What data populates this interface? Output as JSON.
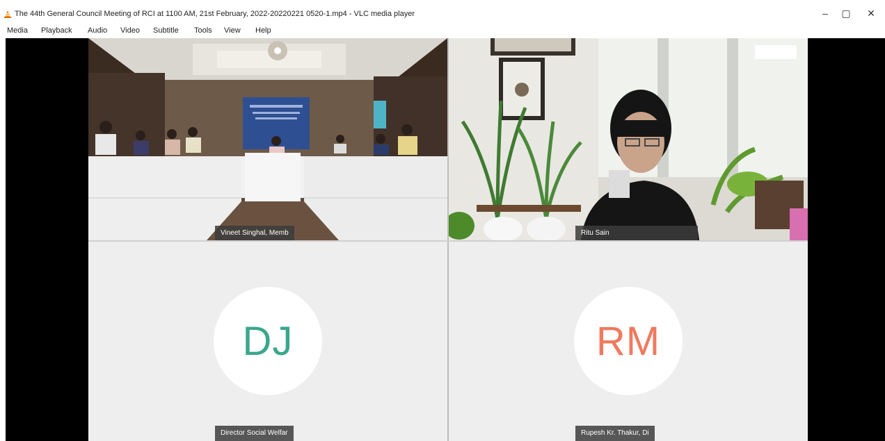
{
  "window": {
    "title": "The 44th General Council Meeting of RCI  at 1100 AM, 21st February, 2022-20220221 0520-1.mp4 - VLC media player",
    "minimize_glyph": "–",
    "maximize_glyph": "▢",
    "close_glyph": "✕",
    "app_icon": "vlc-cone-icon",
    "accent_color": "#f08a00"
  },
  "menubar": {
    "items": [
      "Media",
      "Playback",
      "Audio",
      "Video",
      "Subtitle",
      "Tools",
      "View",
      "Help"
    ]
  },
  "meeting": {
    "participants": [
      {
        "name_tag": "Vineet Singhal, Memb",
        "type": "video"
      },
      {
        "name_tag": "Ritu Sain",
        "type": "video"
      },
      {
        "name_tag": "Director Social Welfar",
        "type": "avatar",
        "initials": "DJ",
        "initials_color": "#3aa78c"
      },
      {
        "name_tag": "Rupesh Kr. Thakur, Di",
        "type": "avatar",
        "initials": "RM",
        "initials_color": "#ef7a5e"
      }
    ]
  }
}
